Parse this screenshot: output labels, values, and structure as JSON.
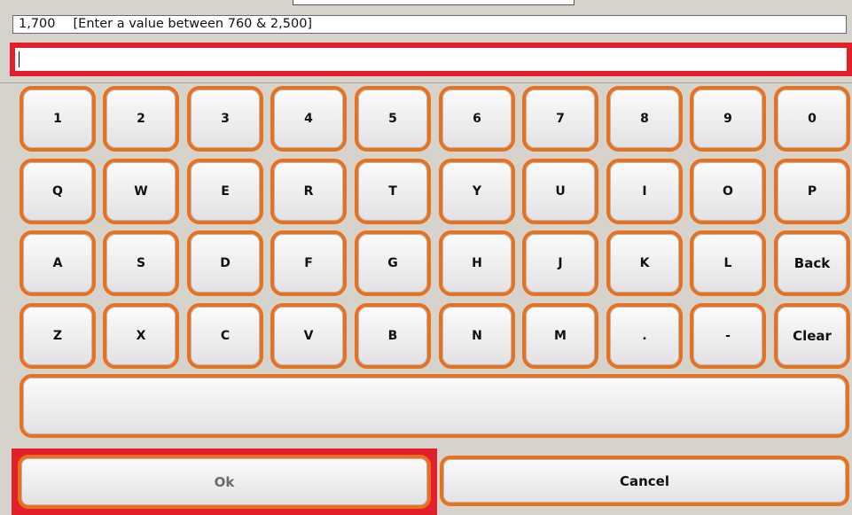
{
  "header": {
    "current_value": "1,700",
    "range_hint": "[Enter a value between 760 & 2,500]"
  },
  "entry": {
    "value": ""
  },
  "keyboard": {
    "rows": [
      [
        "1",
        "2",
        "3",
        "4",
        "5",
        "6",
        "7",
        "8",
        "9",
        "0"
      ],
      [
        "Q",
        "W",
        "E",
        "R",
        "T",
        "Y",
        "U",
        "I",
        "O",
        "P"
      ],
      [
        "A",
        "S",
        "D",
        "F",
        "G",
        "H",
        "J",
        "K",
        "L",
        "Back"
      ],
      [
        "Z",
        "X",
        "C",
        "V",
        "B",
        "N",
        "M",
        ".",
        "-",
        "Clear"
      ]
    ],
    "space_label": ""
  },
  "actions": {
    "ok_label": "Ok",
    "cancel_label": "Cancel"
  },
  "colors": {
    "key_border": "#e8711f",
    "highlight": "#e3202a",
    "background": "#d6d3cd",
    "ok_text": "#6b6b6b"
  }
}
